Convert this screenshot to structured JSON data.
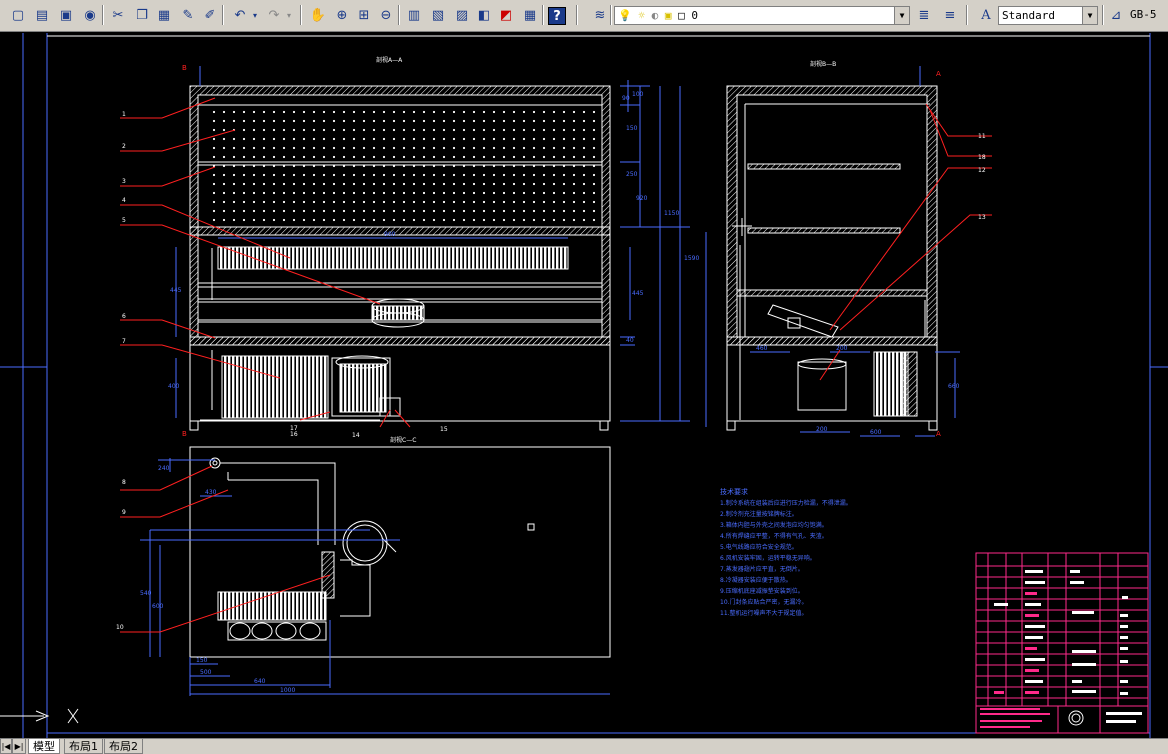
{
  "toolbar": {
    "layer_value": "0",
    "text_style_value": "Standard",
    "dim_style_value": "GB-5"
  },
  "drawing": {
    "title_section_a": "剖视A—A",
    "title_section_b": "剖视B—B",
    "title_section_c": "剖视C—C",
    "section_mark_a": "A",
    "section_mark_a2": "A",
    "section_mark_b": "B",
    "section_mark_b2": "B",
    "callouts": [
      "1",
      "2",
      "3",
      "4",
      "5",
      "6",
      "7",
      "8",
      "9",
      "10",
      "11",
      "12",
      "13",
      "14",
      "15",
      "16",
      "17",
      "18"
    ],
    "dims_a": [
      "90",
      "100",
      "920",
      "1150",
      "1590",
      "900",
      "445",
      "400",
      "445",
      "40",
      "250",
      "150"
    ],
    "dims_b": [
      "460",
      "200",
      "200",
      "600",
      "660"
    ],
    "dims_c": [
      "240",
      "430",
      "540",
      "600",
      "150",
      "500",
      "640",
      "1000"
    ],
    "notes_title": "技术要求",
    "notes": [
      "1.制冷系统在组装后应进行压力检漏，不得泄漏。",
      "2.制冷剂充注量按铭牌标注。",
      "3.箱体内胆与外壳之间发泡应均匀饱满。",
      "4.所有焊缝应平整，不得有气孔、夹渣。",
      "5.电气线路应符合安全规范。",
      "6.风机安装牢固，运转平稳无异响。",
      "7.蒸发器翅片应平直，无倒片。",
      "8.冷凝器安装应便于散热。",
      "9.压缩机底座减振垫安装到位。",
      "10.门封条应贴合严密，无漏冷。",
      "11.整机运行噪声不大于规定值。"
    ]
  },
  "tabs": {
    "model": "模型",
    "layout1": "布局1",
    "layout2": "布局2"
  },
  "colors": {
    "background": "#000000",
    "lines": "#ffffff",
    "dimension": "#4a6cff",
    "leader": "#ff2020",
    "titleblock": "#ff2a8a"
  }
}
